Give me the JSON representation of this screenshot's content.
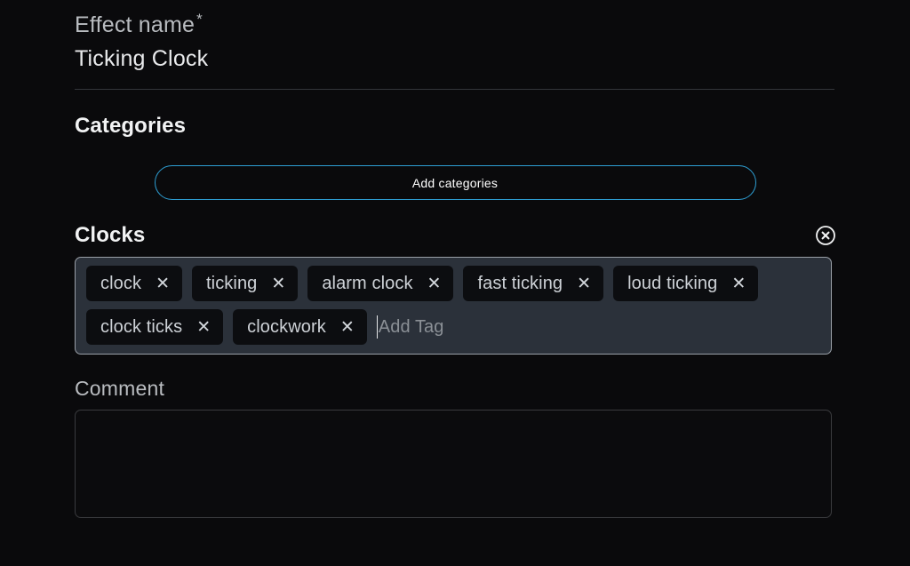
{
  "form": {
    "effect_name": {
      "label": "Effect name",
      "required_marker": "*",
      "value": "Ticking Clock"
    },
    "categories": {
      "heading": "Categories",
      "add_button_label": "Add categories"
    },
    "tags_section": {
      "heading": "Clocks",
      "close_icon": "close-circle-icon",
      "tags": [
        {
          "label": "clock",
          "remove_glyph": "✕"
        },
        {
          "label": "ticking",
          "remove_glyph": "✕"
        },
        {
          "label": "alarm clock",
          "remove_glyph": "✕"
        },
        {
          "label": "fast ticking",
          "remove_glyph": "✕"
        },
        {
          "label": "loud ticking",
          "remove_glyph": "✕"
        },
        {
          "label": "clock ticks",
          "remove_glyph": "✕"
        },
        {
          "label": "clockwork",
          "remove_glyph": "✕"
        }
      ],
      "input": {
        "placeholder": "Add Tag",
        "value": ""
      }
    },
    "comment": {
      "label": "Comment",
      "value": "",
      "placeholder": ""
    }
  },
  "colors": {
    "page_background": "#0a0a0c",
    "accent_blue": "#2e9fd4",
    "tag_container_background": "#2b313a",
    "tag_background": "#0c0d10",
    "text_primary": "#e9eaec",
    "text_muted": "#b9bcc0",
    "divider": "#34363a"
  }
}
